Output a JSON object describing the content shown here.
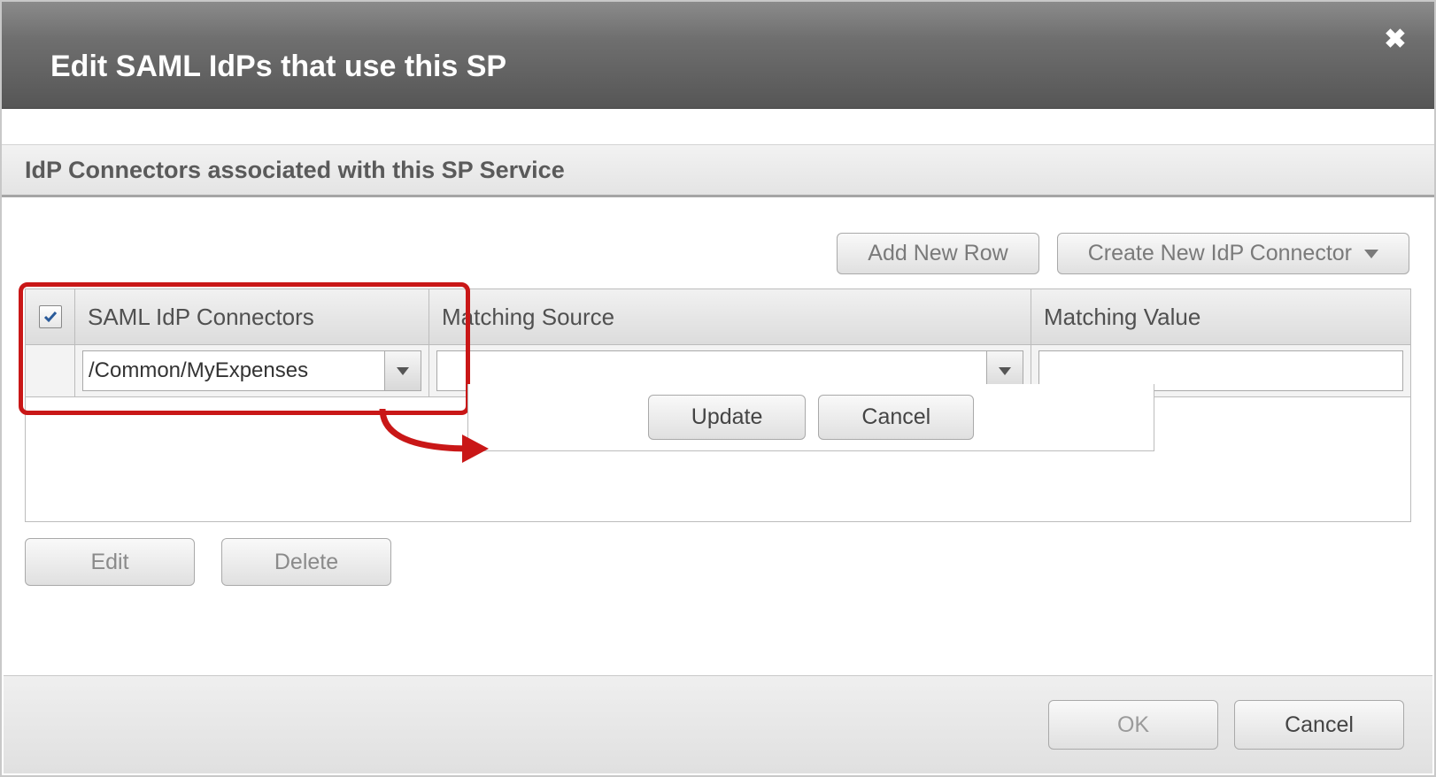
{
  "dialog": {
    "title": "Edit SAML IdPs that use this SP"
  },
  "section": {
    "heading": "IdP Connectors associated with this SP Service"
  },
  "toolbar": {
    "add_new_row": "Add New Row",
    "create_new": "Create New IdP Connector"
  },
  "table": {
    "headers": {
      "connectors": "SAML IdP Connectors",
      "matching_source": "Matching Source",
      "matching_value": "Matching Value"
    },
    "row": {
      "checked": true,
      "connector_value": "/Common/MyExpenses",
      "matching_source_value": "",
      "matching_value_value": ""
    },
    "row_actions": {
      "update": "Update",
      "cancel": "Cancel"
    }
  },
  "below": {
    "edit": "Edit",
    "delete": "Delete"
  },
  "footer": {
    "ok": "OK",
    "cancel": "Cancel"
  }
}
